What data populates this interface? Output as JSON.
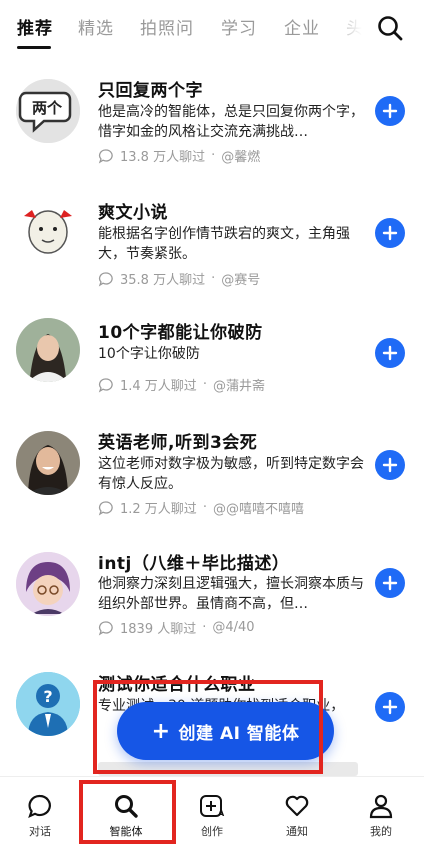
{
  "tabs": [
    "推荐",
    "精选",
    "拍照问",
    "学习",
    "企业",
    "头"
  ],
  "items": [
    {
      "title": "只回复两个字",
      "desc": "他是高冷的智能体，总是只回复你两个字，惜字如金的风格让交流充满挑战…",
      "count": "13.8 万人聊过",
      "author": "@馨燃",
      "avatar_text": "两个"
    },
    {
      "title": "爽文小说",
      "desc": "能根据名字创作情节跌宕的爽文，主角强大，节奏紧张。",
      "count": "35.8 万人聊过",
      "author": "@赛号"
    },
    {
      "title": "10个字都能让你破防",
      "desc": "10个字让你破防",
      "count": "1.4 万人聊过",
      "author": "@蒲井斋"
    },
    {
      "title": "英语老师,听到3会死",
      "desc": "这位老师对数字极为敏感，听到特定数字会有惊人反应。",
      "count": "1.2 万人聊过",
      "author": "@@嘻嘻不嘻嘻"
    },
    {
      "title": "intj（八维＋毕比描述）",
      "desc": "他洞察力深刻且逻辑强大，擅长洞察本质与组织外部世界。虽情商不高，但…",
      "count": "1839 人聊过",
      "author": "@4/40"
    },
    {
      "title": "测试你适合什么职业",
      "desc": "专业测试，30 道题助你找到适合职业，",
      "count": "",
      "author": ""
    }
  ],
  "create_button": {
    "label": "创建 AI 智能体",
    "plus": "+"
  },
  "nav": [
    {
      "label": "对话",
      "icon": "chat-icon"
    },
    {
      "label": "智能体",
      "icon": "search-icon"
    },
    {
      "label": "创作",
      "icon": "ai-create-icon"
    },
    {
      "label": "通知",
      "icon": "heart-icon"
    },
    {
      "label": "我的",
      "icon": "profile-icon"
    }
  ],
  "colors": {
    "accent": "#1f6bf6",
    "highlight": "#e2251f",
    "muted": "#9a9a9a"
  }
}
